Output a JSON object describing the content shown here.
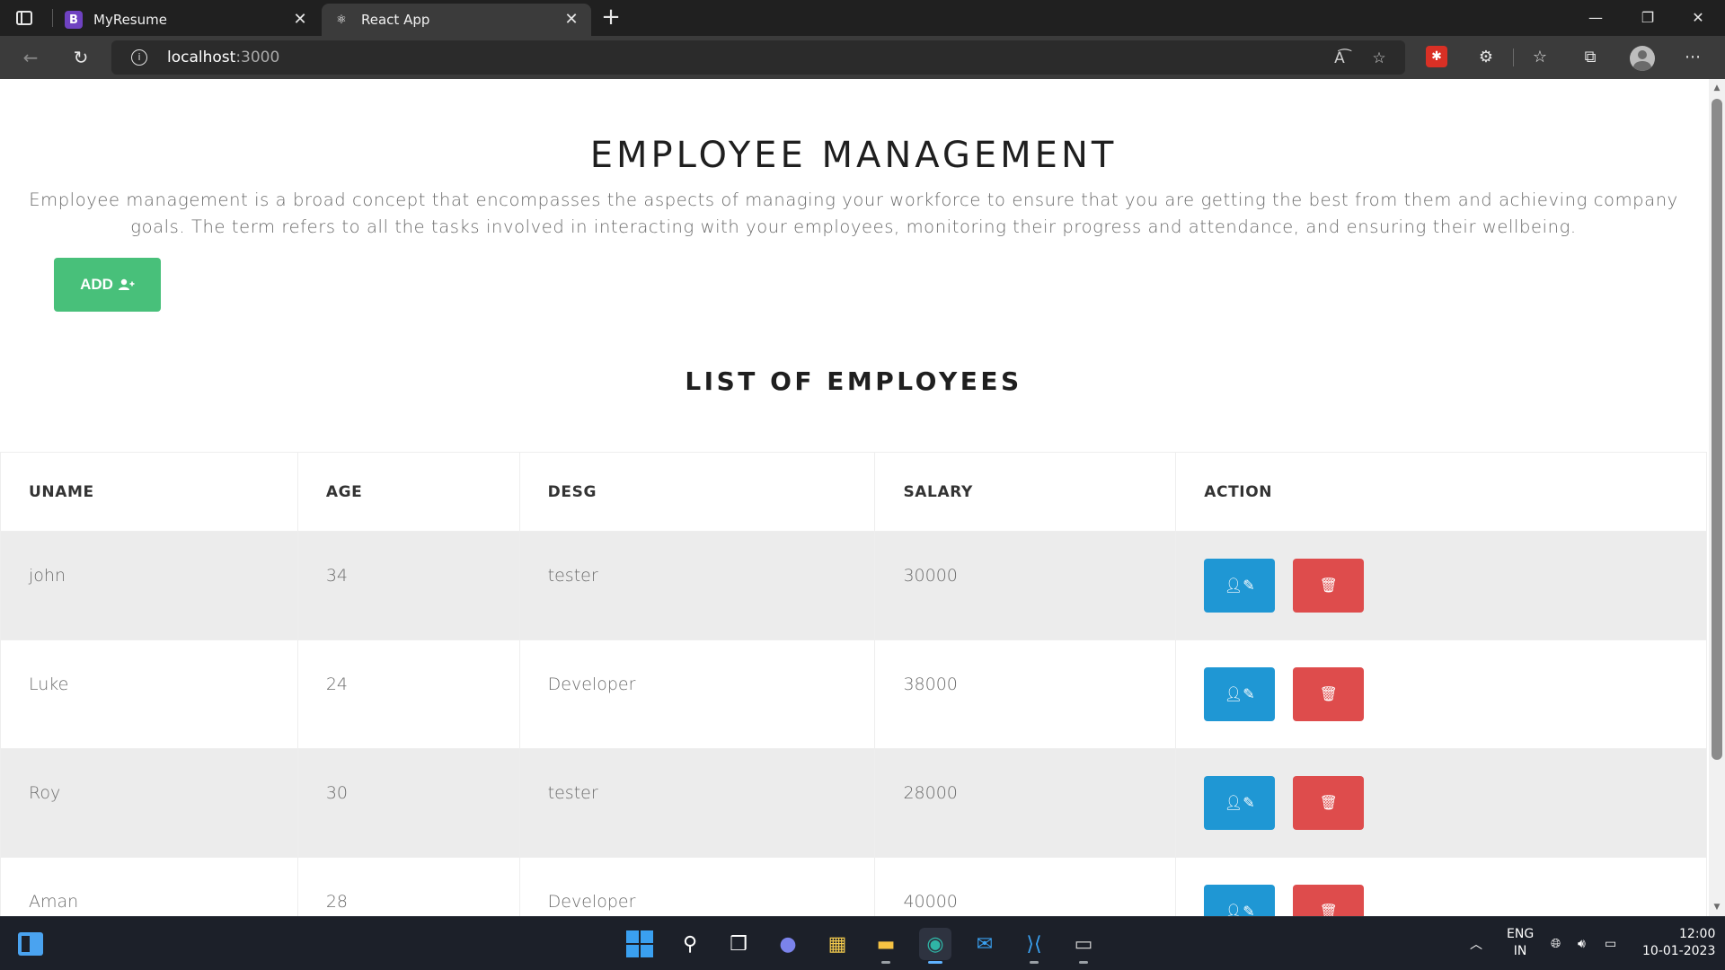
{
  "browser": {
    "tabs": [
      {
        "title": "MyResume",
        "favicon": "B"
      },
      {
        "title": "React App",
        "favicon": "react-icon"
      }
    ],
    "url_host": "localhost",
    "url_port": ":3000"
  },
  "page": {
    "title": "EMPLOYEE MANAGEMENT",
    "description": "Employee management is a broad concept that encompasses the aspects of managing your workforce to ensure that you are getting the best from them and achieving company goals. The term refers to all the tasks involved in interacting with your employees, monitoring their progress and attendance, and ensuring their wellbeing.",
    "add_label": "ADD",
    "list_title": "LIST OF EMPLOYEES",
    "table": {
      "headers": [
        "UNAME",
        "AGE",
        "DESG",
        "SALARY",
        "ACTION"
      ],
      "rows": [
        {
          "uname": "john",
          "age": "34",
          "desg": "tester",
          "salary": "30000"
        },
        {
          "uname": "Luke",
          "age": "24",
          "desg": "Developer",
          "salary": "38000"
        },
        {
          "uname": "Roy",
          "age": "30",
          "desg": "tester",
          "salary": "28000"
        },
        {
          "uname": "Aman",
          "age": "28",
          "desg": "Developer",
          "salary": "40000"
        }
      ]
    }
  },
  "taskbar": {
    "lang_top": "ENG",
    "lang_bottom": "IN",
    "time": "12:00",
    "date": "10-01-2023"
  },
  "colors": {
    "add_button": "#48c07a",
    "edit_button": "#1f97d4",
    "delete_button": "#de4c4c",
    "alt_row": "#ececec"
  }
}
